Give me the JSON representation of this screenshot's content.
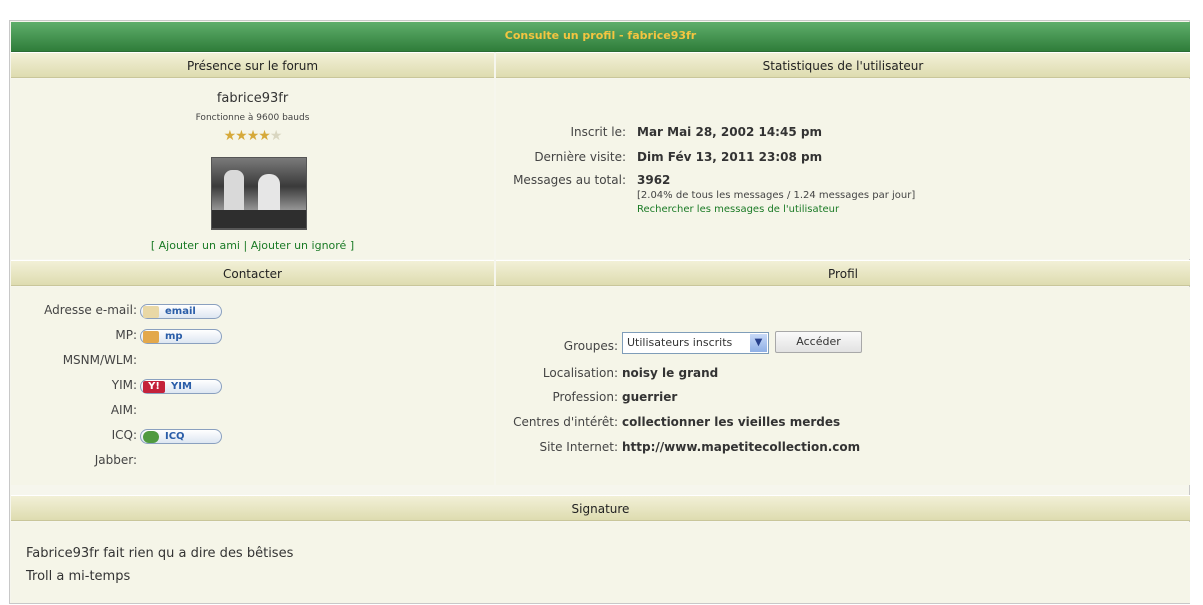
{
  "title": "Consulte un profil - fabrice93fr",
  "headers": {
    "presence": "Présence sur le forum",
    "stats": "Statistiques de l'utilisateur",
    "contact": "Contacter",
    "profile": "Profil",
    "signature": "Signature"
  },
  "user": {
    "name": "fabrice93fr",
    "rank": "Fonctionne à 9600 bauds",
    "stars_filled": 4,
    "stars_total": 5,
    "add_friend": "Ajouter un ami",
    "add_ignored": "Ajouter un ignoré"
  },
  "stats": {
    "joined_label": "Inscrit le:",
    "joined_value": "Mar Mai 28, 2002 14:45 pm",
    "last_visit_label": "Dernière visite:",
    "last_visit_value": "Dim Fév 13, 2011 23:08 pm",
    "posts_label": "Messages au total:",
    "posts_value": "3962",
    "posts_detail": "[2.04% de tous les messages / 1.24 messages par jour]",
    "search_posts": "Rechercher les messages de l'utilisateur"
  },
  "contact": {
    "email_label": "Adresse e-mail:",
    "email_btn": "email",
    "pm_label": "MP:",
    "pm_btn": "mp",
    "msn_label": "MSNM/WLM:",
    "yim_label": "YIM:",
    "yim_btn": "YIM",
    "aim_label": "AIM:",
    "icq_label": "ICQ:",
    "icq_btn": "ICQ",
    "jabber_label": "Jabber:"
  },
  "profile": {
    "groups_label": "Groupes:",
    "groups_selected": "Utilisateurs inscrits",
    "go_btn": "Accéder",
    "location_label": "Localisation:",
    "location_value": "noisy le grand",
    "job_label": "Profession:",
    "job_value": "guerrier",
    "interests_label": "Centres d'intérêt:",
    "interests_value": "collectionner les vieilles merdes",
    "site_label": "Site Internet:",
    "site_value": "http://www.mapetitecollection.com"
  },
  "signature": {
    "line1": "Fabrice93fr fait rien qu a dire des bêtises",
    "line2": "Troll a mi-temps"
  },
  "colors": {
    "title_bg": "#3f8f4a",
    "title_text": "#f4c540",
    "link": "#1a7a25",
    "header_bg": "#e6e4bf",
    "cell_bg": "#f5f5e8"
  }
}
